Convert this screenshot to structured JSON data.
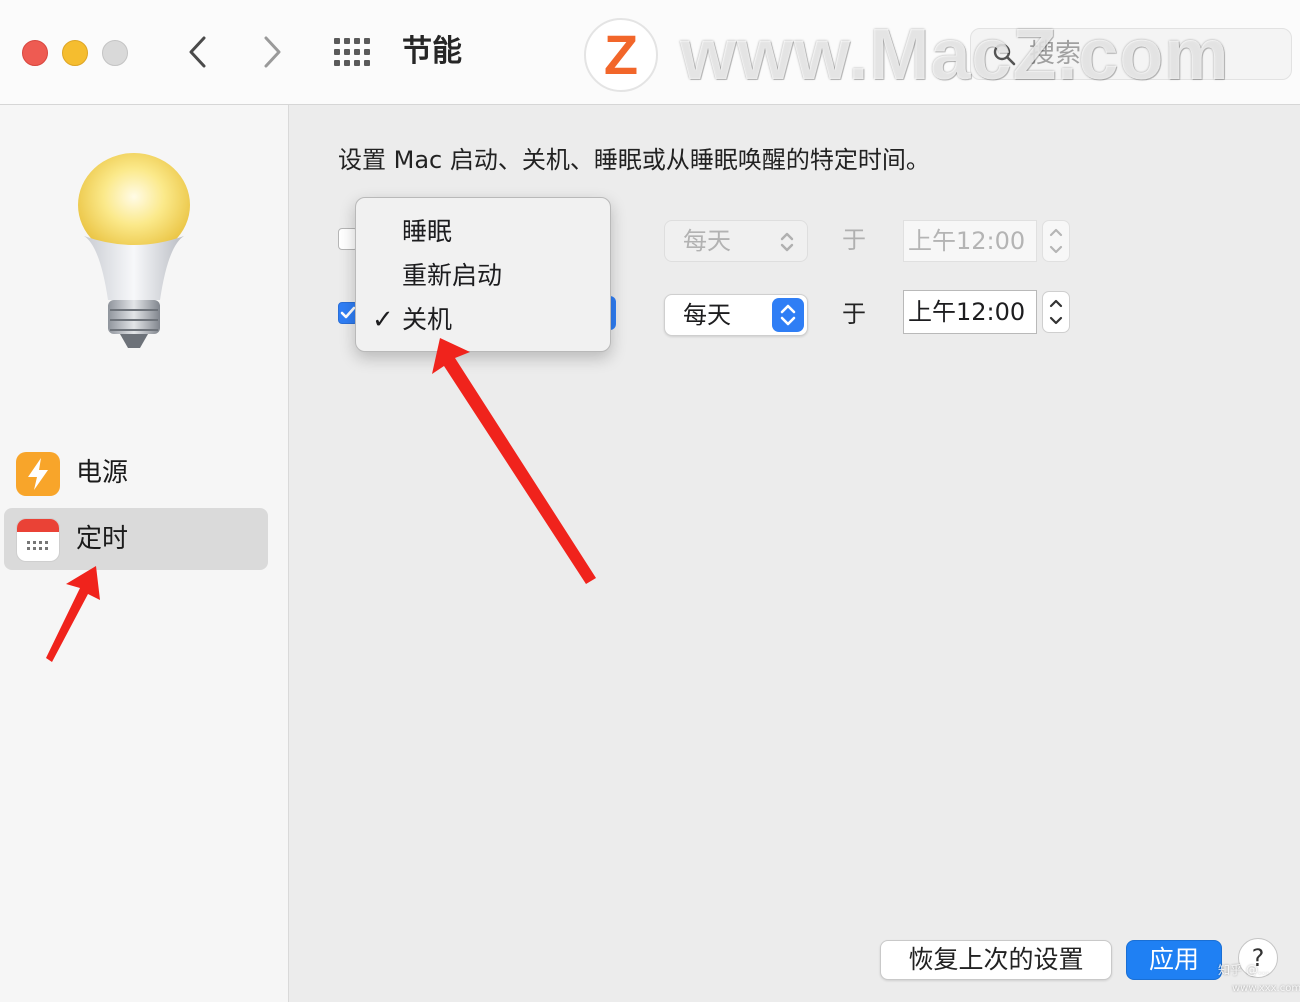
{
  "window": {
    "title": "节能",
    "search_placeholder": "搜索"
  },
  "watermark": {
    "logo_letter": "Z",
    "site": "www.MacZ.com",
    "corner_line1": "知乎 @...",
    "corner_line2": "www.xxx.com"
  },
  "sidebar": {
    "items": [
      {
        "label": "电源",
        "icon": "lightning-bolt-icon",
        "selected": false
      },
      {
        "label": "定时",
        "icon": "calendar-icon",
        "selected": true
      }
    ]
  },
  "main": {
    "description": "设置 Mac 启动、关机、睡眠或从睡眠唤醒的特定时间。",
    "rows": [
      {
        "enabled": false,
        "frequency": "每天",
        "at": "于",
        "time": "上午12:00"
      },
      {
        "enabled": true,
        "frequency": "每天",
        "at": "于",
        "time": "上午12:00"
      }
    ],
    "action_menu": {
      "options": [
        "睡眠",
        "重新启动",
        "关机"
      ],
      "selected": "关机"
    }
  },
  "footer": {
    "revert_label": "恢复上次的设置",
    "apply_label": "应用",
    "help_label": "?"
  },
  "colors": {
    "accent": "#1f80f3",
    "annotation_arrow": "#f0231c"
  }
}
